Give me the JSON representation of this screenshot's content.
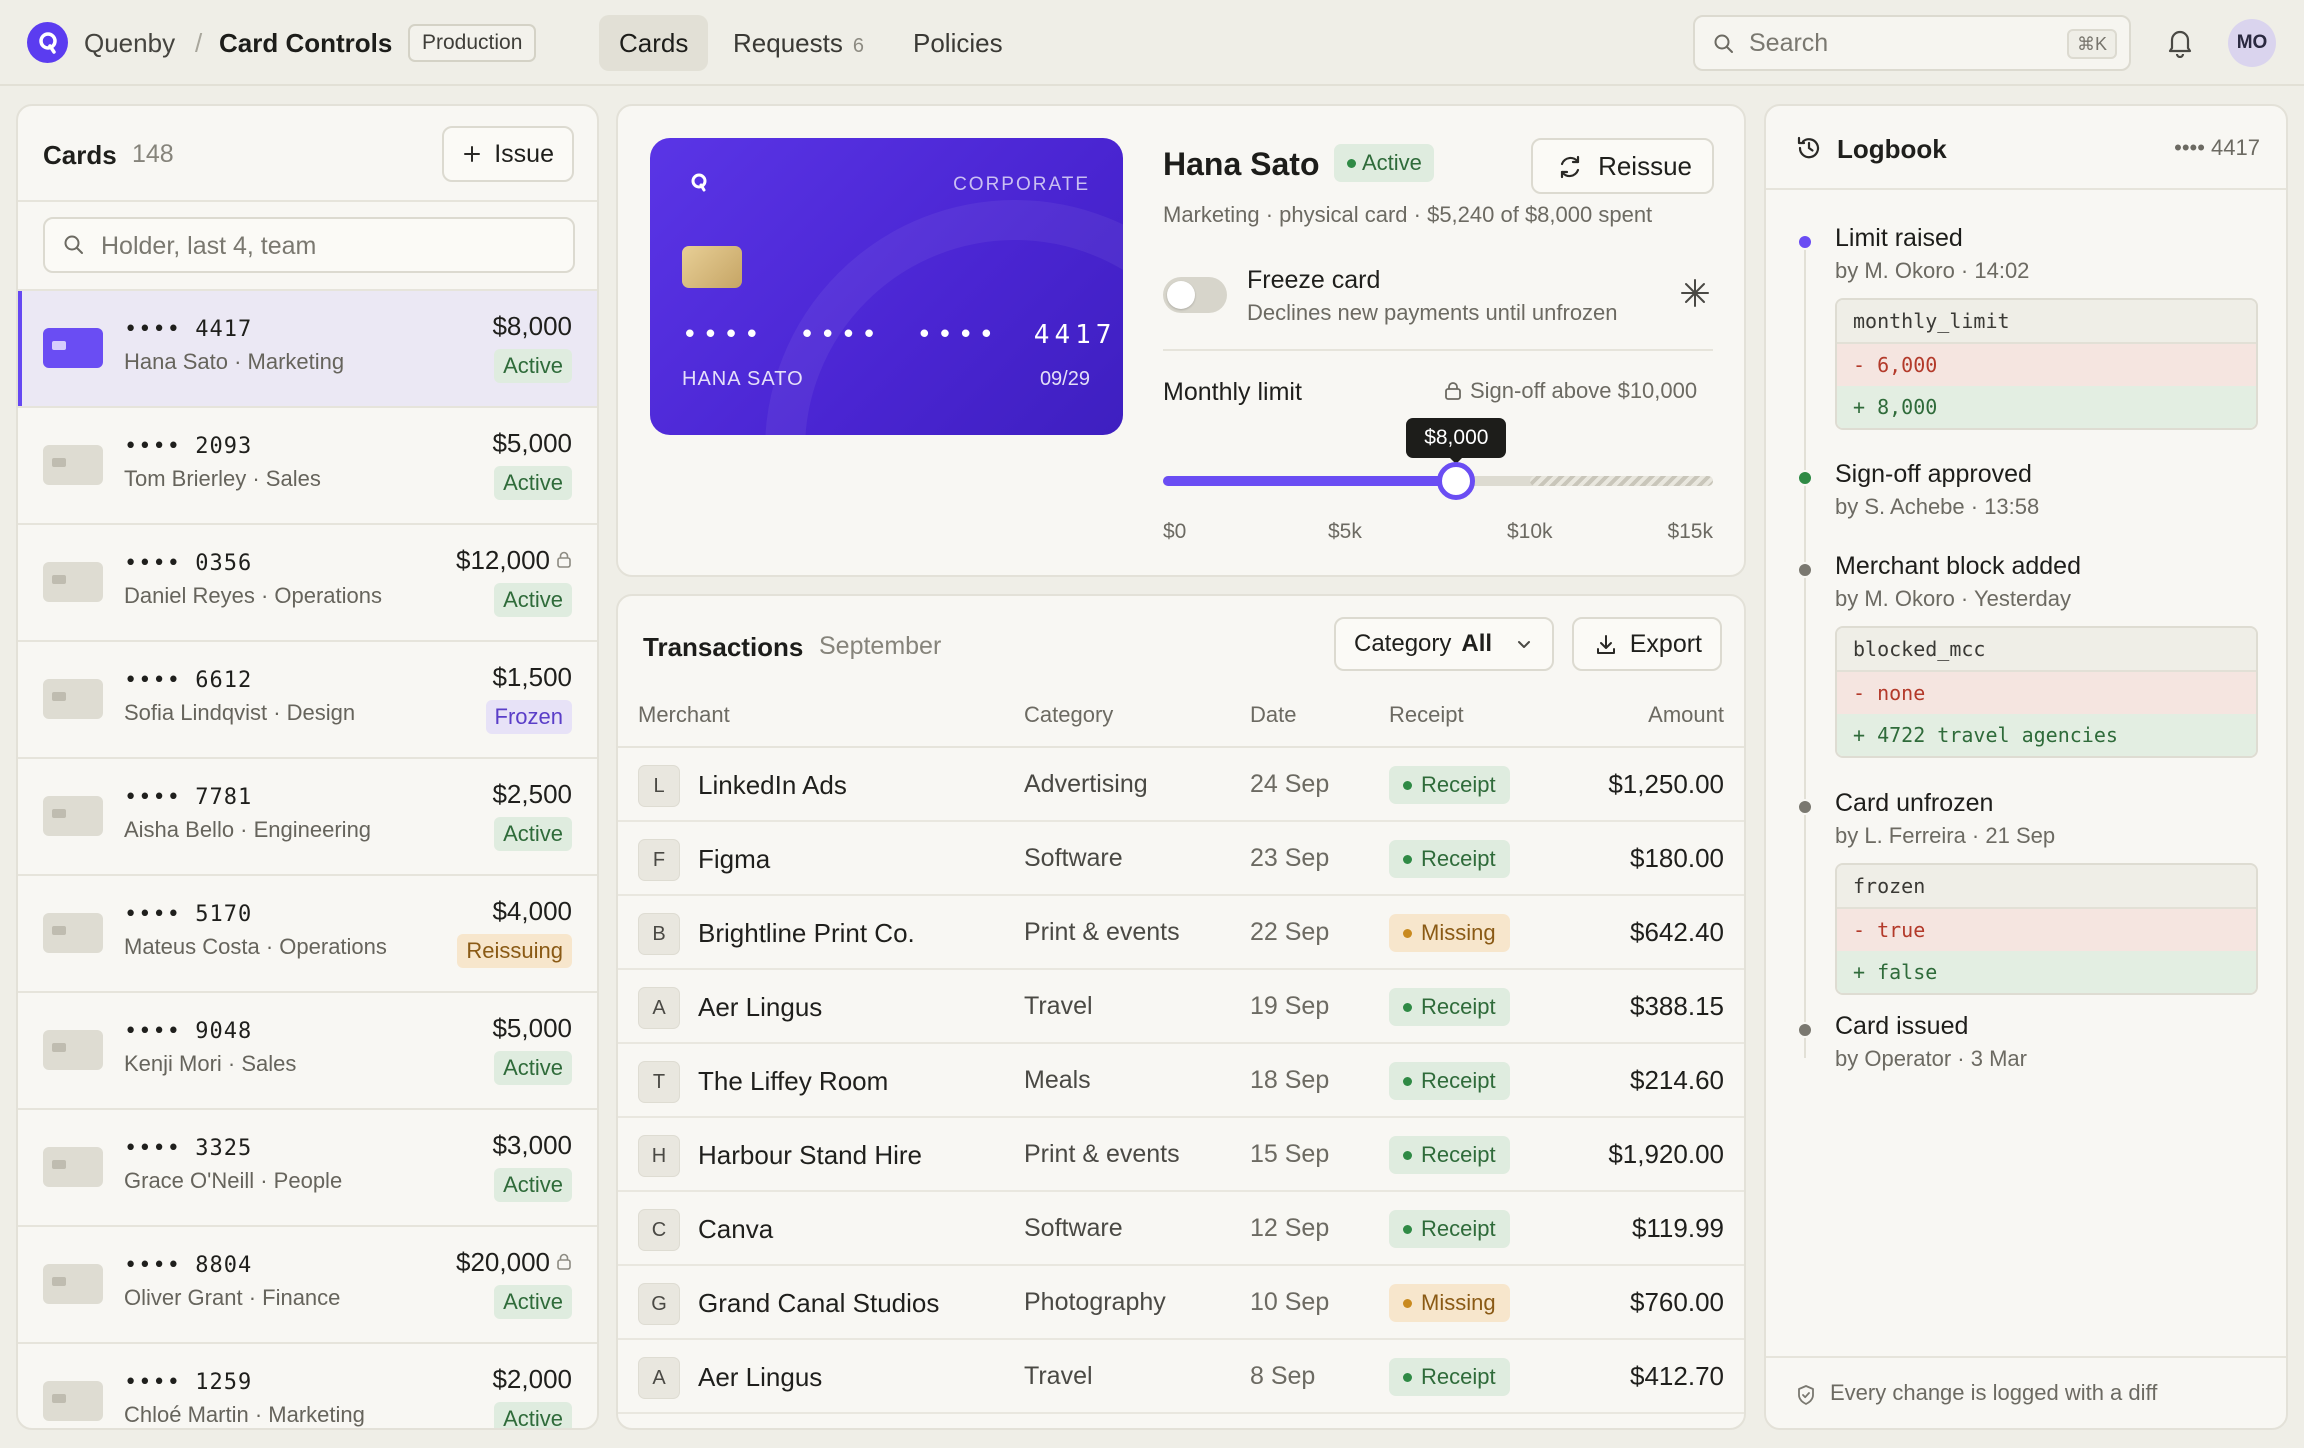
{
  "app": {
    "org": "Quenby",
    "separator": "/",
    "page": "Card Controls",
    "environment": "Production"
  },
  "nav": {
    "tabs": [
      {
        "label": "Cards"
      },
      {
        "label": "Requests",
        "count": "6"
      },
      {
        "label": "Policies"
      }
    ]
  },
  "search": {
    "placeholder": "Search",
    "shortcut": "⌘K"
  },
  "user": {
    "initials": "MO"
  },
  "cards_panel": {
    "title": "Cards",
    "count": "148",
    "issue_label": "Issue",
    "search_placeholder": "Holder, last 4, team",
    "cards": [
      {
        "last4": "•••• 4417",
        "holder": "Hana Sato · Marketing",
        "limit": "$8,000",
        "status": "Active",
        "status_kind": "active",
        "locked": false,
        "selected": true
      },
      {
        "last4": "•••• 2093",
        "holder": "Tom Brierley · Sales",
        "limit": "$5,000",
        "status": "Active",
        "status_kind": "active",
        "locked": false
      },
      {
        "last4": "•••• 0356",
        "holder": "Daniel Reyes · Operations",
        "limit": "$12,000",
        "status": "Active",
        "status_kind": "active",
        "locked": true
      },
      {
        "last4": "•••• 6612",
        "holder": "Sofia Lindqvist · Design",
        "limit": "$1,500",
        "status": "Frozen",
        "status_kind": "frozen",
        "locked": false
      },
      {
        "last4": "•••• 7781",
        "holder": "Aisha Bello · Engineering",
        "limit": "$2,500",
        "status": "Active",
        "status_kind": "active",
        "locked": false
      },
      {
        "last4": "•••• 5170",
        "holder": "Mateus Costa · Operations",
        "limit": "$4,000",
        "status": "Reissuing",
        "status_kind": "reissuing",
        "locked": false
      },
      {
        "last4": "•••• 9048",
        "holder": "Kenji Mori · Sales",
        "limit": "$5,000",
        "status": "Active",
        "status_kind": "active",
        "locked": false
      },
      {
        "last4": "•••• 3325",
        "holder": "Grace O'Neill · People",
        "limit": "$3,000",
        "status": "Active",
        "status_kind": "active",
        "locked": false
      },
      {
        "last4": "•••• 8804",
        "holder": "Oliver Grant · Finance",
        "limit": "$20,000",
        "status": "Active",
        "status_kind": "active",
        "locked": true
      },
      {
        "last4": "•••• 1259",
        "holder": "Chloé Martin · Marketing",
        "limit": "$2,000",
        "status": "Active",
        "status_kind": "active",
        "locked": false
      }
    ]
  },
  "detail": {
    "card": {
      "tier": "CORPORATE",
      "number": "•••• •••• •••• 4417",
      "name": "HANA SATO",
      "expiry": "09/29"
    },
    "holder": "Hana Sato",
    "status": "Active",
    "reissue_label": "Reissue",
    "meta": "Marketing · physical card · $5,240 of $8,000 spent",
    "freeze": {
      "title": "Freeze card",
      "subtitle": "Declines new payments until unfrozen",
      "on": false
    },
    "limit": {
      "label": "Monthly limit",
      "signoff": "Sign-off above $10,000",
      "value_label": "$8,000",
      "value": 8000,
      "max": 15000,
      "signoff_threshold": 10000,
      "ticks": [
        "$0",
        "$5k",
        "$10k",
        "$15k"
      ]
    }
  },
  "transactions": {
    "title": "Transactions",
    "period": "September",
    "category_label": "Category",
    "category_value": "All",
    "export_label": "Export",
    "columns": {
      "merchant": "Merchant",
      "category": "Category",
      "date": "Date",
      "receipt": "Receipt",
      "amount": "Amount"
    },
    "rows": [
      {
        "initial": "L",
        "merchant": "LinkedIn Ads",
        "category": "Advertising",
        "date": "24 Sep",
        "receipt": "Receipt",
        "receipt_kind": "ok",
        "amount": "$1,250.00"
      },
      {
        "initial": "F",
        "merchant": "Figma",
        "category": "Software",
        "date": "23 Sep",
        "receipt": "Receipt",
        "receipt_kind": "ok",
        "amount": "$180.00"
      },
      {
        "initial": "B",
        "merchant": "Brightline Print Co.",
        "category": "Print & events",
        "date": "22 Sep",
        "receipt": "Missing",
        "receipt_kind": "missing",
        "amount": "$642.40"
      },
      {
        "initial": "A",
        "merchant": "Aer Lingus",
        "category": "Travel",
        "date": "19 Sep",
        "receipt": "Receipt",
        "receipt_kind": "ok",
        "amount": "$388.15"
      },
      {
        "initial": "T",
        "merchant": "The Liffey Room",
        "category": "Meals",
        "date": "18 Sep",
        "receipt": "Receipt",
        "receipt_kind": "ok",
        "amount": "$214.60"
      },
      {
        "initial": "H",
        "merchant": "Harbour Stand Hire",
        "category": "Print & events",
        "date": "15 Sep",
        "receipt": "Receipt",
        "receipt_kind": "ok",
        "amount": "$1,920.00"
      },
      {
        "initial": "C",
        "merchant": "Canva",
        "category": "Software",
        "date": "12 Sep",
        "receipt": "Receipt",
        "receipt_kind": "ok",
        "amount": "$119.99"
      },
      {
        "initial": "G",
        "merchant": "Grand Canal Studios",
        "category": "Photography",
        "date": "10 Sep",
        "receipt": "Missing",
        "receipt_kind": "missing",
        "amount": "$760.00"
      },
      {
        "initial": "A",
        "merchant": "Aer Lingus",
        "category": "Travel",
        "date": "8 Sep",
        "receipt": "Receipt",
        "receipt_kind": "ok",
        "amount": "$412.70"
      }
    ]
  },
  "logbook": {
    "title": "Logbook",
    "ref": "•••• 4417",
    "footer": "Every change is logged with a diff",
    "events": [
      {
        "title": "Limit raised",
        "by": "by M. Okoro · 14:02",
        "color": "#6a4df3",
        "diff": {
          "key": "monthly_limit",
          "old": "- 6,000",
          "new": "+ 8,000"
        }
      },
      {
        "title": "Sign-off approved",
        "by": "by S. Achebe · 13:58",
        "color": "#2f8a45"
      },
      {
        "title": "Merchant block added",
        "by": "by M. Okoro · Yesterday",
        "color": "#7a7870",
        "diff": {
          "key": "blocked_mcc",
          "old": "- none",
          "new": "+ 4722 travel agencies"
        }
      },
      {
        "title": "Card unfrozen",
        "by": "by L. Ferreira · 21 Sep",
        "color": "#7a7870",
        "diff": {
          "key": "frozen",
          "old": "- true",
          "new": "+ false"
        }
      },
      {
        "title": "Card issued",
        "by": "by Operator · 3 Mar",
        "color": "#7a7870"
      }
    ]
  }
}
